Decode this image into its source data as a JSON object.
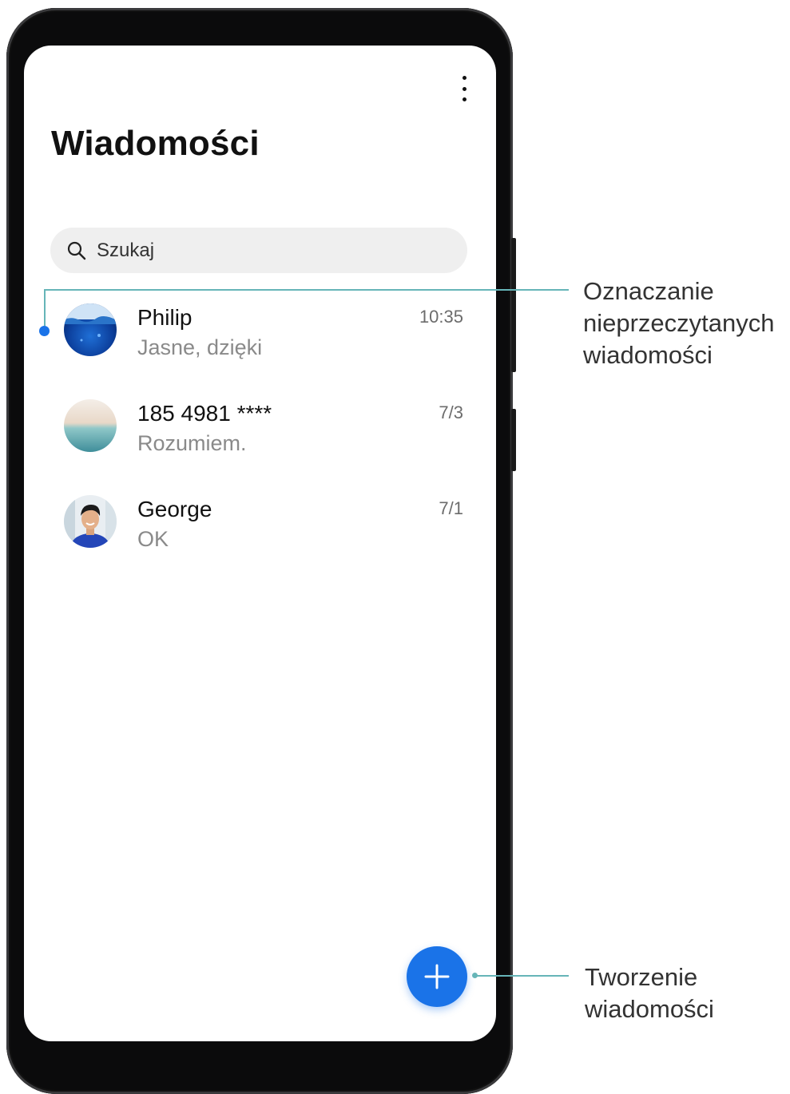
{
  "screen": {
    "title": "Wiadomości",
    "search": {
      "placeholder": "Szukaj"
    },
    "conversations": [
      {
        "name": "Philip",
        "preview": "Jasne, dzięki",
        "time": "10:35",
        "unread": true
      },
      {
        "name": "185 4981 ****",
        "preview": "Rozumiem.",
        "time": "7/3",
        "unread": false
      },
      {
        "name": "George",
        "preview": "OK",
        "time": "7/1",
        "unread": false
      }
    ],
    "accent_color": "#1a73e8"
  },
  "callouts": {
    "unread_marking": "Oznaczanie nieprzeczytanych wiadomości",
    "unread_marking_lines": [
      "Oznaczanie",
      "nieprzeczytanych",
      "wiadomości"
    ],
    "compose": "Tworzenie wiadomości",
    "compose_lines": [
      "Tworzenie",
      "wiadomości"
    ]
  }
}
